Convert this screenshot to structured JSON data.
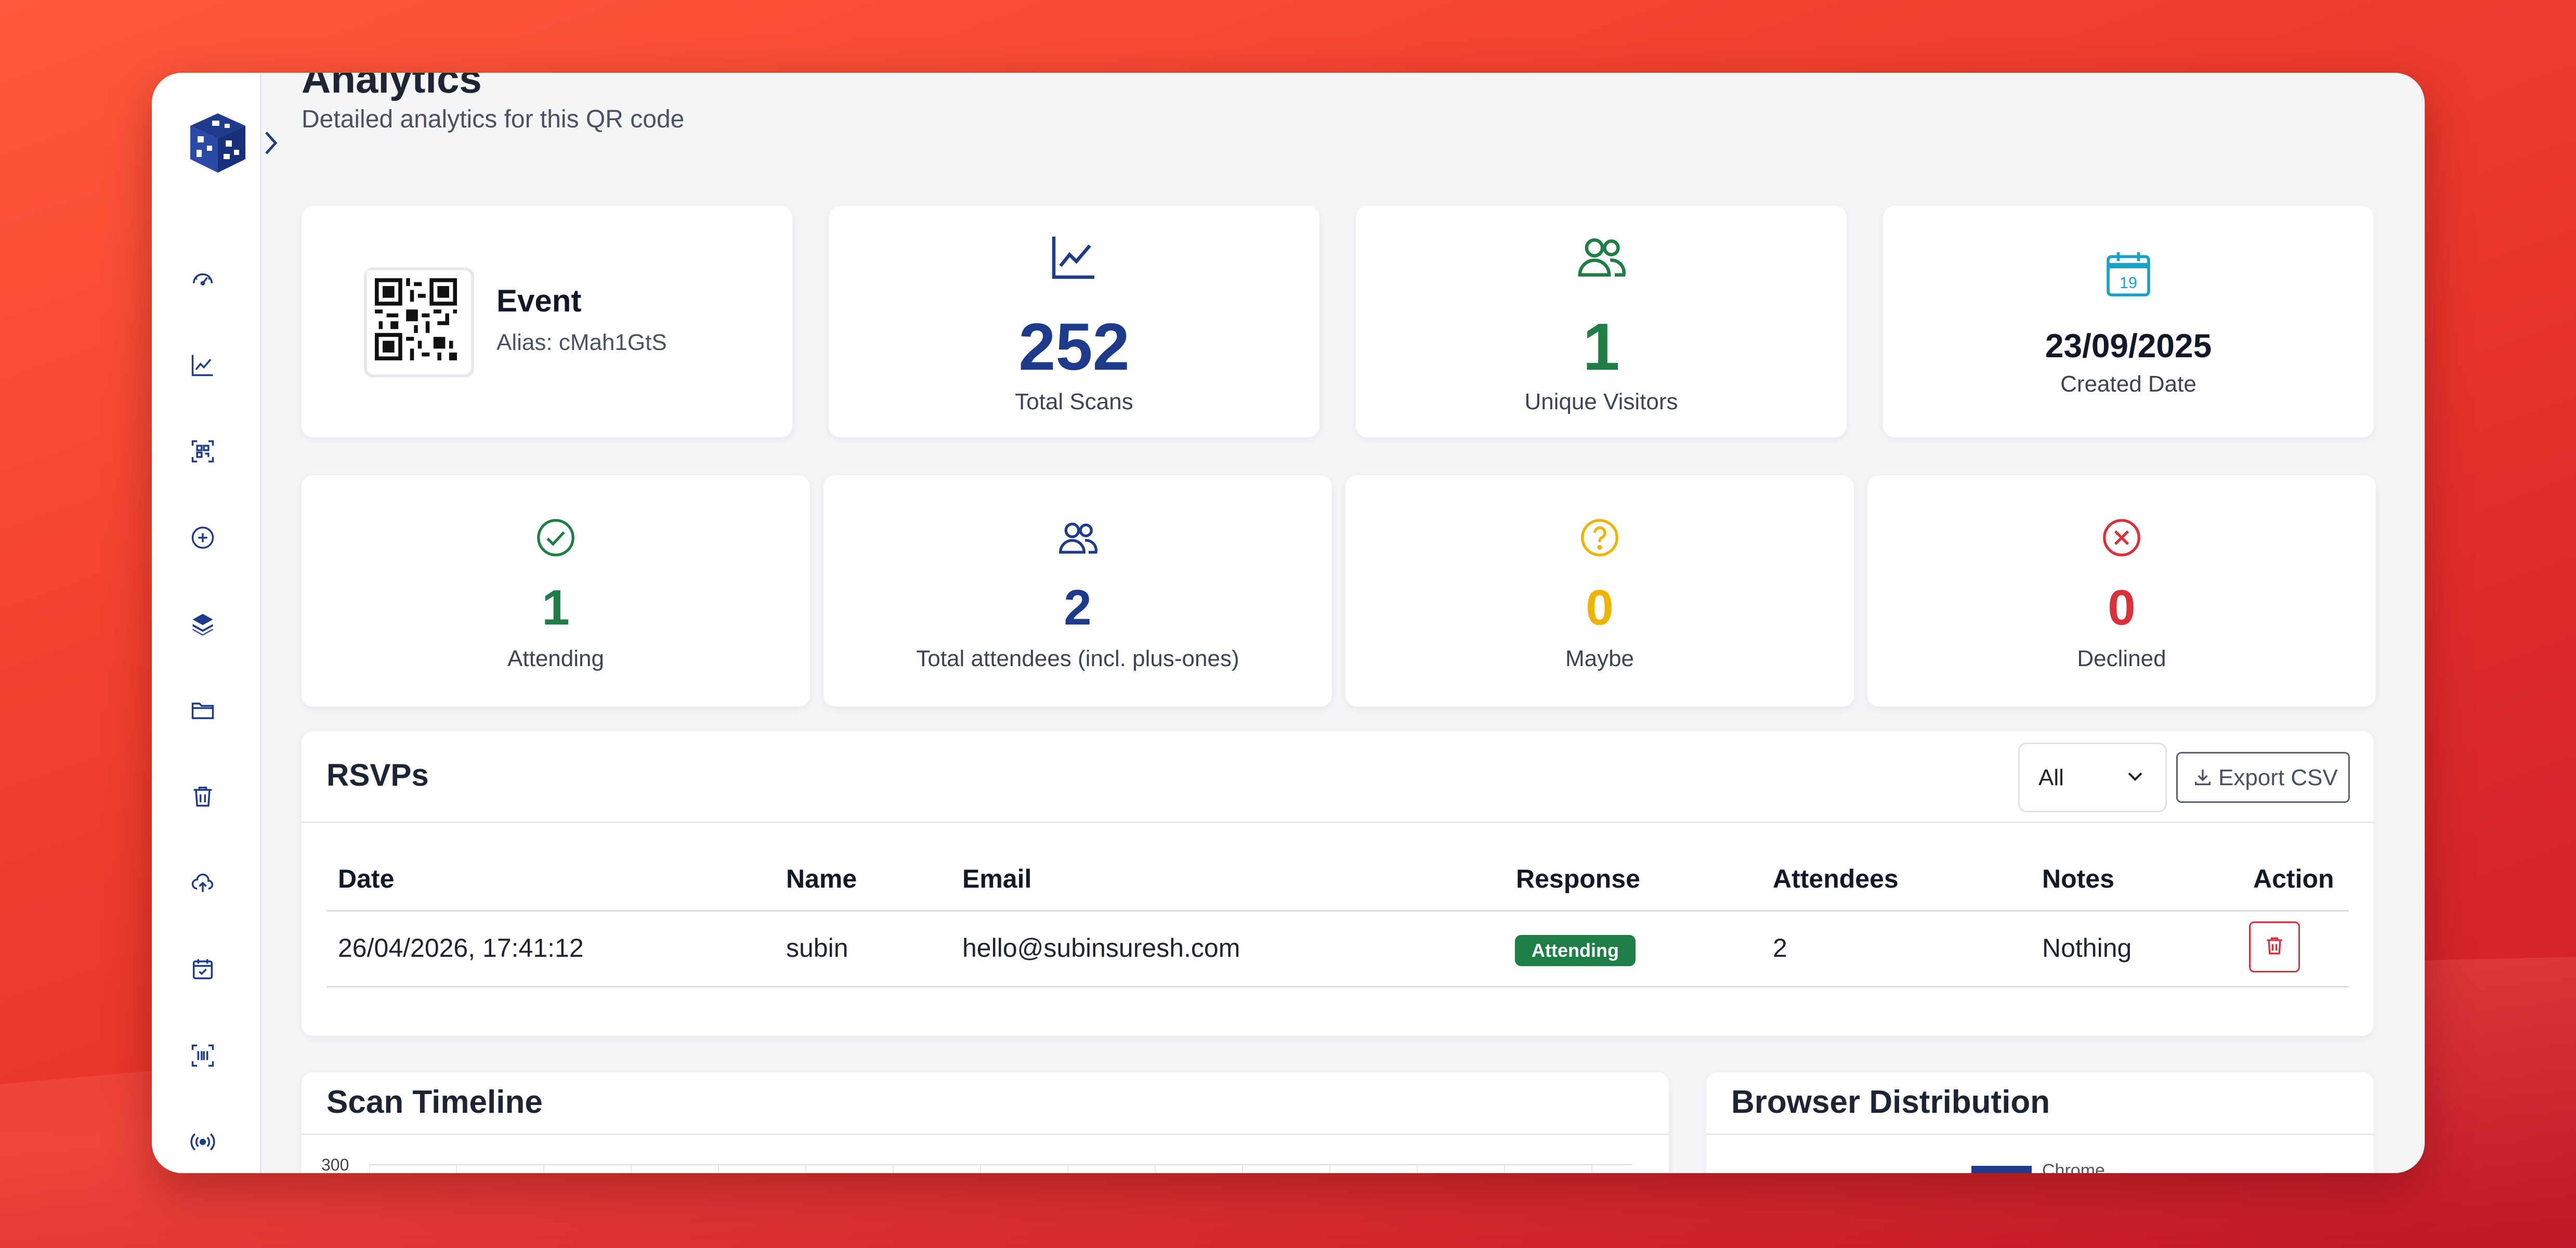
{
  "page": {
    "title": "Analytics",
    "subtitle": "Detailed analytics for this QR code"
  },
  "sidebar": {
    "items": [
      {
        "icon": "dashboard-icon"
      },
      {
        "icon": "chart-line-icon"
      },
      {
        "icon": "qr-code-icon"
      },
      {
        "icon": "plus-circle-icon"
      },
      {
        "icon": "layers-icon"
      },
      {
        "icon": "folder-icon"
      },
      {
        "icon": "trash-icon"
      },
      {
        "icon": "cloud-upload-icon"
      },
      {
        "icon": "calendar-check-icon"
      },
      {
        "icon": "barcode-scan-icon"
      },
      {
        "icon": "broadcast-icon"
      }
    ]
  },
  "summary": {
    "event_name": "Event",
    "alias": "Alias: cMah1GtS",
    "total_scans": "252",
    "total_scans_label": "Total Scans",
    "unique_visitors": "1",
    "unique_visitors_label": "Unique Visitors",
    "calendar_day": "19",
    "created_date": "23/09/2025",
    "created_date_label": "Created Date"
  },
  "rsvp_stats": {
    "attending": "1",
    "attending_label": "Attending",
    "total_attendees": "2",
    "total_attendees_label": "Total attendees (incl. plus-ones)",
    "maybe": "0",
    "maybe_label": "Maybe",
    "declined": "0",
    "declined_label": "Declined"
  },
  "rsvps": {
    "title": "RSVPs",
    "filter_value": "All",
    "export_label": "Export CSV",
    "columns": [
      "Date",
      "Name",
      "Email",
      "Response",
      "Attendees",
      "Notes",
      "Action"
    ],
    "rows": [
      {
        "date": "26/04/2026, 17:41:12",
        "name": "subin",
        "email": "hello@subinsuresh.com",
        "response": "Attending",
        "attendees": "2",
        "notes": "Nothing"
      }
    ]
  },
  "scan_timeline": {
    "title": "Scan Timeline",
    "y_top_tick": "300"
  },
  "browser_distribution": {
    "title": "Browser Distribution",
    "legend_first": "Chrome"
  },
  "colors": {
    "navy": "#1e3a8a",
    "green": "#1e7e45",
    "amber": "#f0b400",
    "red": "#dc2f3a",
    "teal": "#17a2c8"
  }
}
